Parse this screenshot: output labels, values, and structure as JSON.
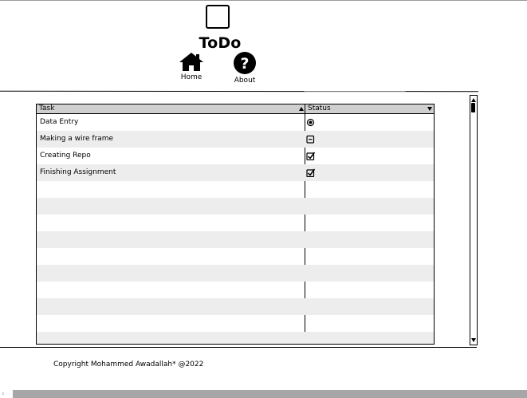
{
  "header": {
    "logo_icon": "placeholder-square-icon",
    "title": "ToDo",
    "nav": [
      {
        "label": "Home",
        "icon": "home-icon"
      },
      {
        "label": "About",
        "icon": "help-circle-icon"
      }
    ]
  },
  "table": {
    "columns": [
      {
        "label": "Task",
        "sort": "ascending"
      },
      {
        "label": "Status",
        "sort": "dropdown"
      }
    ],
    "rows": [
      {
        "task": "Data Entry",
        "status": "radio-selected"
      },
      {
        "task": "Making a wire frame",
        "status": "indeterminate"
      },
      {
        "task": "Creating Repo",
        "status": "checked"
      },
      {
        "task": "Finishing Assignment",
        "status": "checked"
      },
      {
        "task": "",
        "status": ""
      },
      {
        "task": "",
        "status": ""
      },
      {
        "task": "",
        "status": ""
      },
      {
        "task": "",
        "status": ""
      },
      {
        "task": "",
        "status": ""
      },
      {
        "task": "",
        "status": ""
      },
      {
        "task": "",
        "status": ""
      },
      {
        "task": "",
        "status": ""
      },
      {
        "task": "",
        "status": ""
      },
      {
        "task": "",
        "status": ""
      }
    ]
  },
  "footer": {
    "copyright": "Copyright  Mohammed Awadallah* @2022"
  },
  "colors": {
    "header_bg": "#cfcfcf",
    "alt_row": "#ededed",
    "scrollbar_bottom": "#a6a6a6"
  }
}
